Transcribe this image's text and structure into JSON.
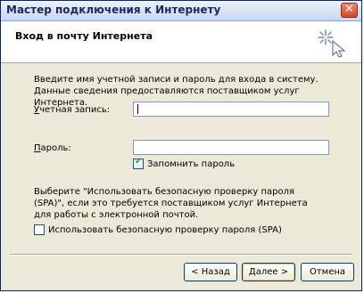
{
  "window": {
    "title": "Мастер подключения к Интернету",
    "close_glyph": "✕"
  },
  "header": {
    "title": "Вход в почту Интернета",
    "icon": "wizard-wand-icon"
  },
  "form": {
    "description": "Введите имя учетной записи и пароль для входа в систему. Данные сведения предоставляются поставщиком услуг Интернета.",
    "account_label": "Учетная запись:",
    "account_value": "",
    "password_label": "Пароль:",
    "password_value": "",
    "remember_password_label": "Запомнить пароль",
    "remember_password_checked": true,
    "spa_description": "Выберите \"Использовать безопасную проверку пароля (SPA)\", если это требуется поставщиком услуг Интернета для работы с электронной почтой.",
    "spa_label": "Использовать безопасную проверку пароля (SPA)",
    "spa_checked": false
  },
  "buttons": {
    "back": "< Назад",
    "next": "Далее >",
    "cancel": "Отмена"
  }
}
